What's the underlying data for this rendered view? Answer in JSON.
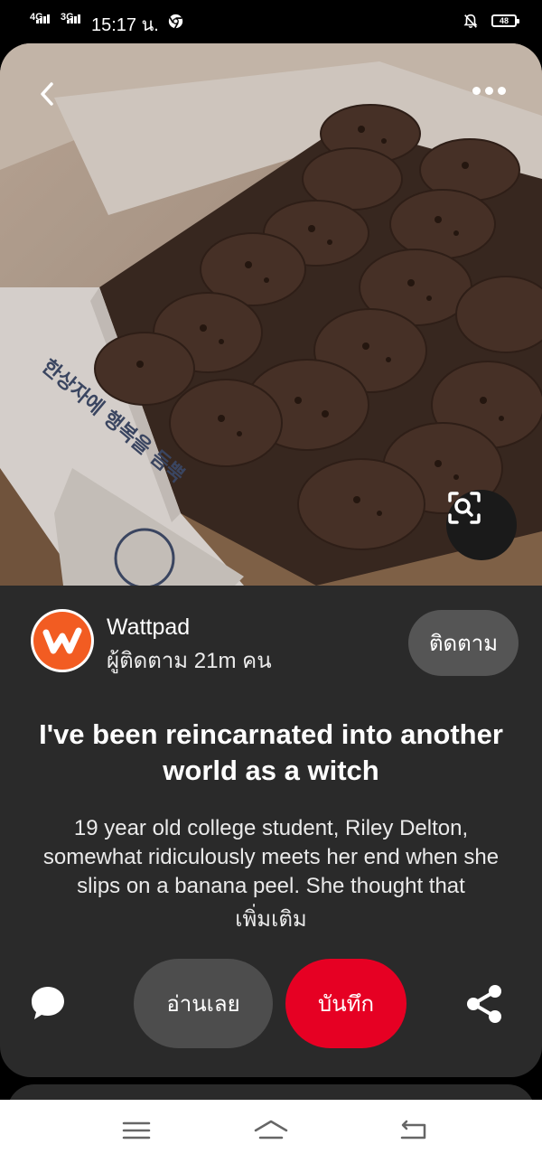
{
  "status_bar": {
    "network1": "4G",
    "network2": "3G",
    "time": "15:17 น.",
    "battery": "48",
    "icons": [
      "chrome-icon",
      "muted-bell-icon",
      "battery-icon"
    ]
  },
  "pin": {
    "image_alt": "cookie box",
    "image_text": "한상자에 행복을 듬뿍",
    "author": {
      "name": "Wattpad",
      "followers": "ผู้ติดตาม 21m คน",
      "follow_label": "ติดตาม",
      "brand_color": "#f25c22"
    },
    "title": "I've been reincarnated into another world as a witch",
    "description": "19 year old college student, Riley Delton, somewhat ridiculously meets her end when she slips on a banana peel. She thought that",
    "more_label": "เพิ่มเติม",
    "actions": {
      "read_label": "อ่านเลย",
      "save_label": "บันทึก",
      "save_color": "#e60023"
    }
  },
  "icons": {
    "back": "back-arrow-icon",
    "more": "more-options-icon",
    "visual_search": "visual-search-icon",
    "comment": "comment-icon",
    "share": "share-icon"
  },
  "nav_bar": {
    "buttons": [
      "menu-icon",
      "home-icon",
      "back-icon"
    ]
  }
}
